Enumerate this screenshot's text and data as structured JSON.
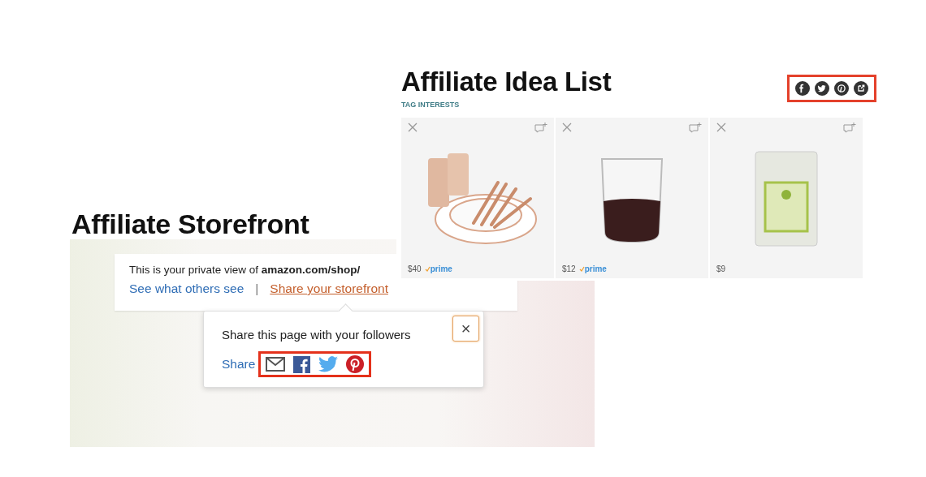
{
  "idea_list": {
    "title": "Affiliate Idea List",
    "tag": "TAG INTERESTS",
    "share_icons": [
      {
        "kind": "facebook"
      },
      {
        "kind": "twitter"
      },
      {
        "kind": "pinterest"
      },
      {
        "kind": "external"
      }
    ],
    "products": [
      {
        "kind": "tableware",
        "price": "$40",
        "badge": "prime"
      },
      {
        "kind": "glass",
        "price": "$12",
        "badge": "prime"
      },
      {
        "kind": "bag",
        "price": "$9"
      }
    ]
  },
  "storefront": {
    "title": "Affiliate Storefront",
    "notice": "This is your private view of **amazon.com/shop/**",
    "links": [
      {
        "label": "See what others see",
        "underlined": false
      },
      {
        "label": "Share your storefront",
        "underlined": true
      }
    ],
    "separator": "|",
    "popup": {
      "message": "Share this page with your followers",
      "share_label": "Share",
      "close": "×",
      "icons": [
        {
          "kind": "email"
        },
        {
          "kind": "facebook"
        },
        {
          "kind": "twitter"
        },
        {
          "kind": "pinterest"
        }
      ]
    }
  }
}
